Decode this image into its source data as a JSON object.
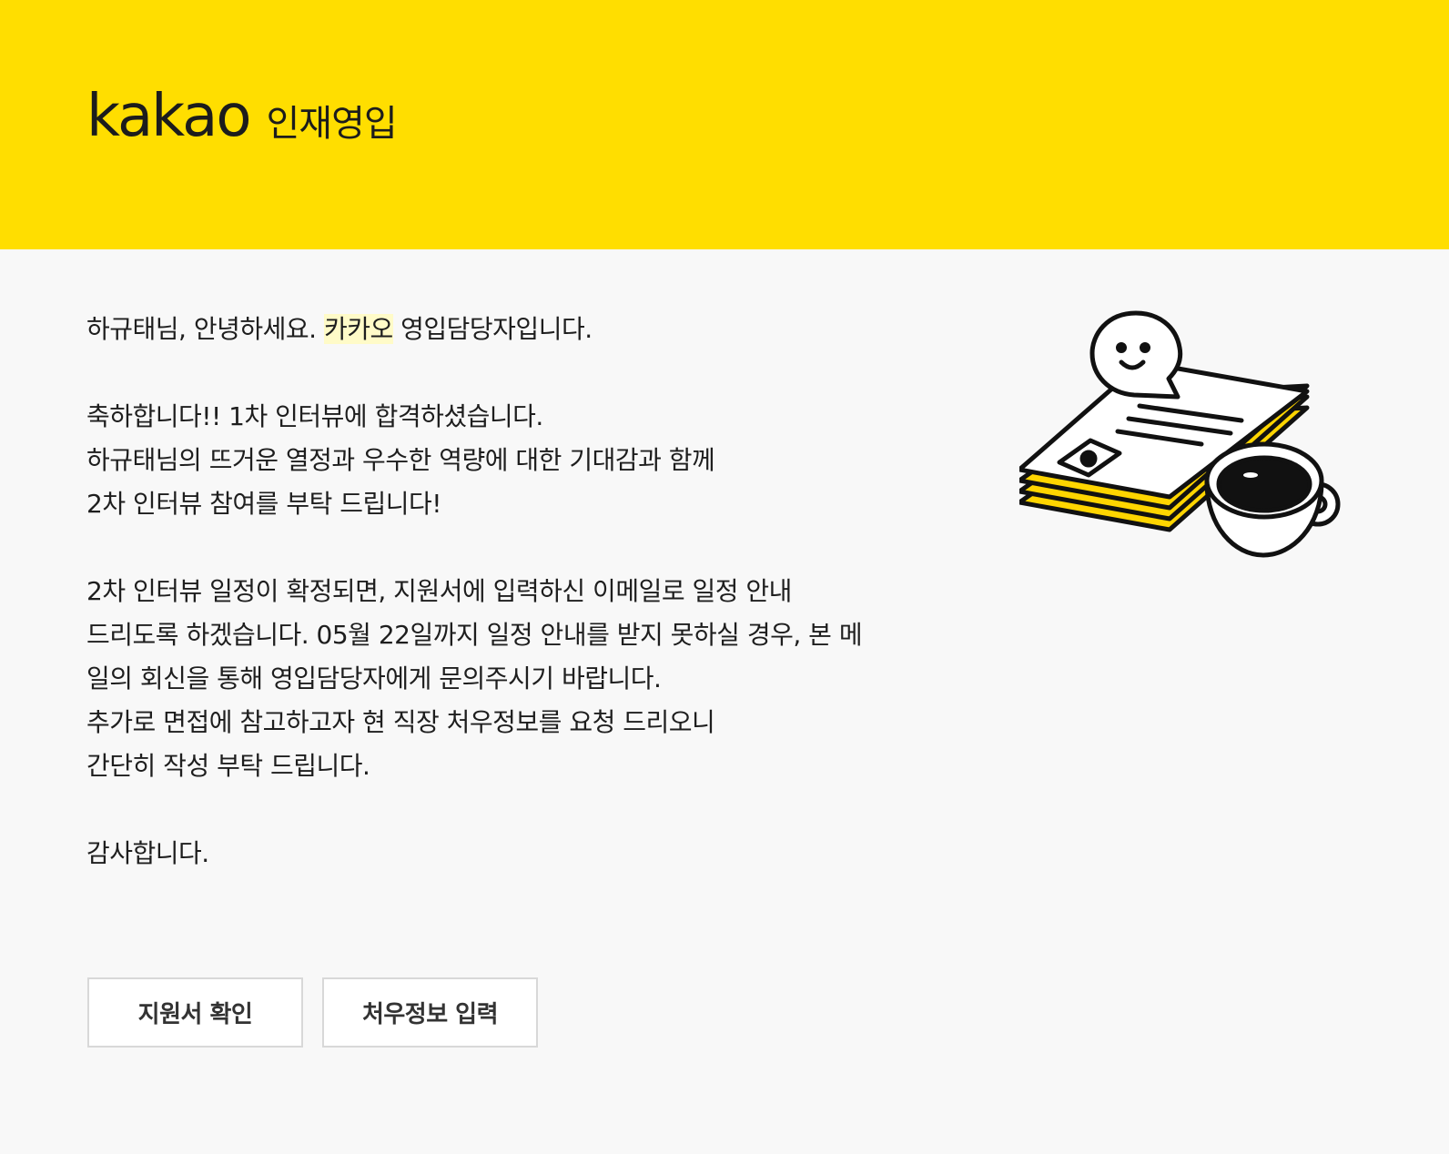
{
  "header": {
    "logo_word": "kakao",
    "logo_sub": "인재영입",
    "background_color": "#ffde00"
  },
  "greeting": {
    "prefix": "하규태님, 안녕하세요. ",
    "highlight": "카카오",
    "suffix": " 영입담당자입니다."
  },
  "para2": [
    "축하합니다!! 1차 인터뷰에 합격하셨습니다.",
    "하규태님의 뜨거운 열정과 우수한 역량에 대한 기대감과 함께",
    "2차 인터뷰 참여를 부탁 드립니다!"
  ],
  "para3": [
    "2차 인터뷰 일정이 확정되면, 지원서에 입력하신 이메일로 일정 안내",
    "드리도록 하겠습니다. 05월 22일까지 일정 안내를 받지 못하실 경우, 본 메",
    "일의 회신을 통해 영입담당자에게 문의주시기 바랍니다.",
    "추가로 면접에 참고하고자 현 직장 처우정보를 요청 드리오니",
    "간단히 작성 부탁 드립니다."
  ],
  "closing": "감사합니다.",
  "buttons": {
    "view_application": "지원서 확인",
    "enter_compensation": "처우정보 입력"
  },
  "illustration": {
    "icon": "documents-coffee-illustration"
  }
}
